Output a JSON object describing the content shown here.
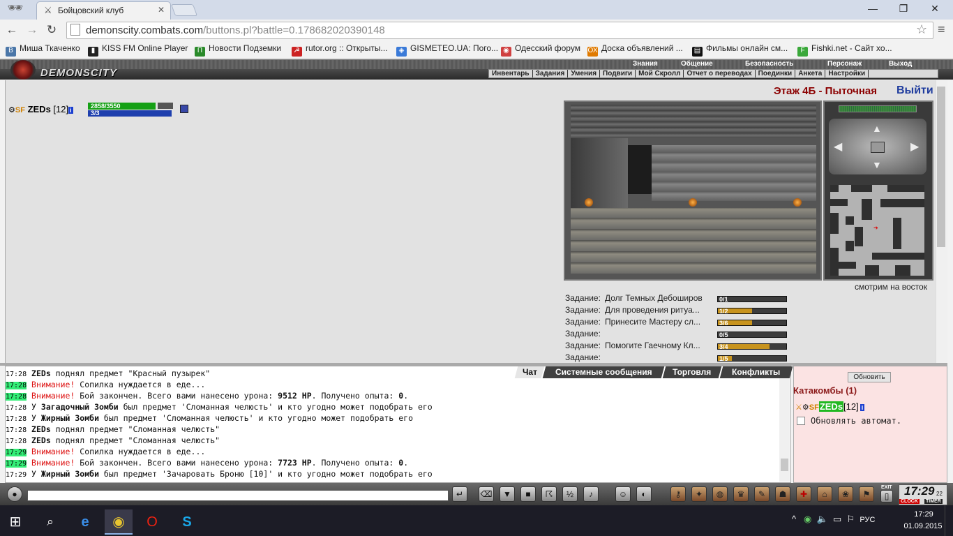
{
  "browser": {
    "tab_title": "Бойцовский клуб",
    "url_host": "demonscity.combats.com",
    "url_path": "/buttons.pl?battle=0.178682020390148"
  },
  "bookmarks": [
    {
      "label": "Миша Ткаченко",
      "color": "#4a76a8",
      "glyph": "В"
    },
    {
      "label": "KISS FM Online Player",
      "color": "#222222",
      "glyph": "▮"
    },
    {
      "label": "Новости Подземки",
      "color": "#2a8a2a",
      "glyph": "П"
    },
    {
      "label": "rutor.org :: Открыты...",
      "color": "#cc2222",
      "glyph": "☭"
    },
    {
      "label": "GISMETEO.UA: Пого...",
      "color": "#3a7ad8",
      "glyph": "◈"
    },
    {
      "label": "Одесский форум",
      "color": "#d04040",
      "glyph": "◉"
    },
    {
      "label": "Доска объявлений ...",
      "color": "#e07a00",
      "glyph": "ОХ"
    },
    {
      "label": "Фильмы онлайн см...",
      "color": "#111111",
      "glyph": "▤"
    },
    {
      "label": "Fishki.net - Сайт хо...",
      "color": "#3aa83a",
      "glyph": "F"
    }
  ],
  "game": {
    "logo_text": "DEMONSCITY",
    "nav_top": [
      "Знания",
      "Общение",
      "Безопасность",
      "Персонаж",
      "Выход"
    ],
    "nav_bottom": [
      "Инвентарь",
      "Задания",
      "Умения",
      "Подвиги",
      "Мой Скролл",
      "Отчет о переводах",
      "Поединки",
      "Анкета",
      "Настройки"
    ],
    "floor_title": "Этаж 4Б - Пыточная",
    "exit_label": "Выйти",
    "facing": "смотрим на восток",
    "hero": {
      "name": "ZEDs",
      "level": "[12]",
      "hp": "2858/3550",
      "hp_fraction": 0.805,
      "mana": "3/3"
    },
    "quests": [
      {
        "prefix": "Задание:",
        "title": "Долг Темных Дебоширов",
        "progress": "0/1",
        "fraction": 0
      },
      {
        "prefix": "Задание:",
        "title": "Для проведения ритуа...",
        "progress": "1/2",
        "fraction": 0.5
      },
      {
        "prefix": "Задание:",
        "title": "Принесите Мастеру сл...",
        "progress": "3/6",
        "fraction": 0.5
      },
      {
        "prefix": "Задание:",
        "title": "",
        "progress": "0/5",
        "fraction": 0
      },
      {
        "prefix": "Задание:",
        "title": "Помогите Гаечному Кл...",
        "progress": "3/4",
        "fraction": 0.75
      },
      {
        "prefix": "Задание:",
        "title": "",
        "progress": "1/5",
        "fraction": 0.2
      }
    ]
  },
  "chat": {
    "tabs": [
      "Чат",
      "Системные сообщения",
      "Торговля",
      "Конфликты"
    ],
    "lines": [
      {
        "time": "17:28",
        "hl": false,
        "parts": [
          {
            "t": "ZEDs",
            "b": true
          },
          {
            "t": " поднял предмет \"Красный пузырек\""
          }
        ]
      },
      {
        "time": "17:28",
        "hl": true,
        "parts": [
          {
            "t": "Внимание!",
            "r": true
          },
          {
            "t": " Сопилка нуждается в еде..."
          }
        ]
      },
      {
        "time": "17:28",
        "hl": true,
        "parts": [
          {
            "t": "Внимание!",
            "r": true
          },
          {
            "t": " Бой закончен. Всего вами нанесено урона: "
          },
          {
            "t": "9512 HP",
            "b": true
          },
          {
            "t": ". Получено опыта: "
          },
          {
            "t": "0",
            "b": true
          },
          {
            "t": "."
          }
        ]
      },
      {
        "time": "17:28",
        "hl": false,
        "parts": [
          {
            "t": "У "
          },
          {
            "t": "Загадочный Зомби",
            "b": true
          },
          {
            "t": " был предмет 'Сломанная челюсть' и кто угодно может подобрать его"
          }
        ]
      },
      {
        "time": "17:28",
        "hl": false,
        "parts": [
          {
            "t": "У "
          },
          {
            "t": "Жирный Зомби",
            "b": true
          },
          {
            "t": " был предмет 'Сломанная челюсть' и кто угодно может подобрать его"
          }
        ]
      },
      {
        "time": "17:28",
        "hl": false,
        "parts": [
          {
            "t": "ZEDs",
            "b": true
          },
          {
            "t": " поднял предмет \"Сломанная челюсть\""
          }
        ]
      },
      {
        "time": "17:28",
        "hl": false,
        "parts": [
          {
            "t": "ZEDs",
            "b": true
          },
          {
            "t": " поднял предмет \"Сломанная челюсть\""
          }
        ]
      },
      {
        "time": "17:29",
        "hl": true,
        "parts": [
          {
            "t": "Внимание!",
            "r": true
          },
          {
            "t": " Сопилка нуждается в еде..."
          }
        ]
      },
      {
        "time": "17:29",
        "hl": true,
        "parts": [
          {
            "t": "Внимание!",
            "r": true
          },
          {
            "t": " Бой закончен. Всего вами нанесено урона: "
          },
          {
            "t": "7723 HP",
            "b": true
          },
          {
            "t": ". Получено опыта: "
          },
          {
            "t": "0",
            "b": true
          },
          {
            "t": "."
          }
        ]
      },
      {
        "time": "17:29",
        "hl": false,
        "parts": [
          {
            "t": "У "
          },
          {
            "t": "Жирный Зомби",
            "b": true
          },
          {
            "t": " был предмет 'Зачаровать Броню [10]' и кто угодно может подобрать его"
          }
        ]
      }
    ]
  },
  "room": {
    "refresh_label": "Обновить",
    "location": "Катакомбы (1)",
    "player_name": "ZEDs",
    "player_level": "[12]",
    "auto_refresh_label": "Обновлять автомат."
  },
  "clock": {
    "time": "17:29",
    "seconds": "22",
    "clock_label": "CLOCK",
    "timer_label": "TIMER",
    "exit_label": "EXIT"
  },
  "taskbar": {
    "lang": "РУС",
    "time": "17:29",
    "date": "01.09.2015"
  }
}
